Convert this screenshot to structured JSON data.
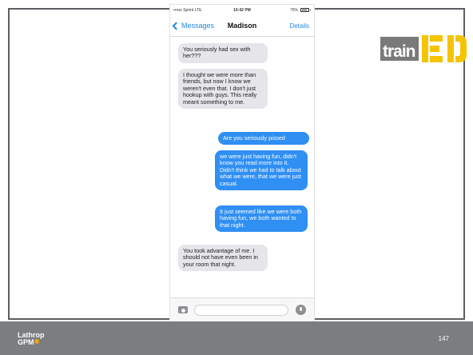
{
  "phone": {
    "status": {
      "carrier": "•••oo Sprint  LTE",
      "time": "10:42 PM",
      "battery": "75%"
    },
    "nav": {
      "back_label": "Messages",
      "contact": "Madison",
      "details_label": "Details"
    },
    "messages": [
      {
        "direction": "incoming",
        "text": "You seriously had sex with her???"
      },
      {
        "direction": "incoming",
        "text": "I thought we were more than friends, but now I know we weren't even that. I don't just hookup with guys. This really meant something to me."
      },
      {
        "direction": "outgoing",
        "text": "Are you seriously pissed"
      },
      {
        "direction": "outgoing",
        "text": "we were just having fun, didn't know you read more into it. Didn't think we had to talk about what we were, that we were just casual."
      },
      {
        "direction": "outgoing",
        "text": "It just seemed like we were both having fun, we both wanted to that night."
      },
      {
        "direction": "incoming",
        "text": "You took advantage of me. I should not have even been in your room that night."
      }
    ],
    "input": {
      "placeholder": ""
    }
  },
  "logo": {
    "text": "train",
    "letters": "ED"
  },
  "footer": {
    "brand_line1": "Lathrop",
    "brand_line2": "GPM",
    "page_number": "147"
  },
  "colors": {
    "outgoing": "#2f8ff3",
    "incoming": "#e5e5ea",
    "accent_blue": "#1d87e6",
    "footer": "#7b7d80",
    "logo_yellow": "#f5c400"
  },
  "icons": [
    "chevron-left-icon",
    "battery-icon",
    "camera-icon",
    "microphone-icon"
  ]
}
